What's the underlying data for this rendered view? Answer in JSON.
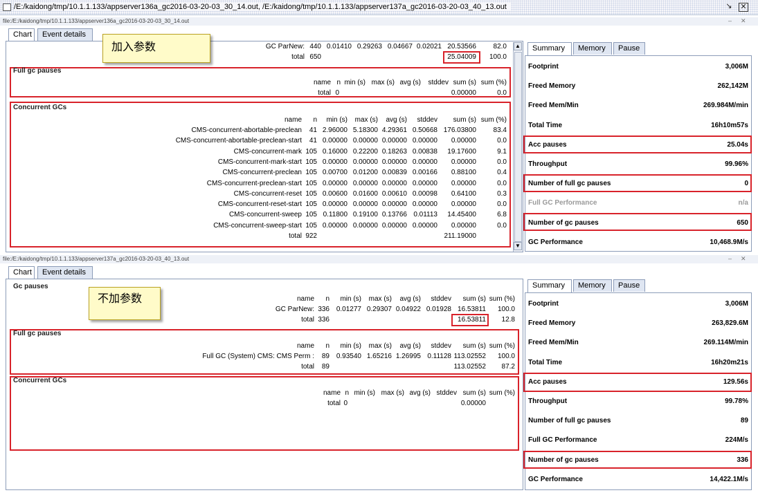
{
  "window": {
    "title": "/E:/kaidong/tmp/10.1.1.133/appserver136a_gc2016-03-20-03_30_14.out, /E:/kaidong/tmp/10.1.1.133/appserver137a_gc2016-03-20-03_40_13.out",
    "restore_icon": "restore-icon",
    "close_icon": "close-icon"
  },
  "top": {
    "file_label": "file:/E:/kaidong/tmp/10.1.1.133/appserver136a_gc2016-03-20-03_30_14.out",
    "tabs": [
      "Chart",
      "Event details"
    ],
    "note": "加入参数",
    "gc_parnew": {
      "name": "GC ParNew:",
      "n": "440",
      "min": "0.01410",
      "max": "0.29263",
      "avg": "0.04667",
      "stddev": "0.02021",
      "sum": "20.53566",
      "pct": "82.0"
    },
    "gc_total": {
      "name": "total",
      "n": "650",
      "sum": "25.04009",
      "pct": "100.0"
    },
    "full_gc": {
      "title": "Full gc pauses",
      "headers": [
        "name",
        "n",
        "min (s)",
        "max (s)",
        "avg (s)",
        "stddev",
        "sum (s)",
        "sum (%)"
      ],
      "total": {
        "name": "total",
        "n": "0",
        "sum": "0.00000",
        "pct": "0.0"
      }
    },
    "concurrent": {
      "title": "Concurrent GCs",
      "headers": [
        "name",
        "n",
        "min (s)",
        "max (s)",
        "avg (s)",
        "stddev",
        "sum (s)",
        "sum (%)"
      ],
      "rows": [
        {
          "name": "CMS-concurrent-abortable-preclean",
          "n": "41",
          "min": "2.96000",
          "max": "5.18300",
          "avg": "4.29361",
          "stddev": "0.50668",
          "sum": "176.03800",
          "pct": "83.4"
        },
        {
          "name": "CMS-concurrent-abortable-preclean-start",
          "n": "41",
          "min": "0.00000",
          "max": "0.00000",
          "avg": "0.00000",
          "stddev": "0.00000",
          "sum": "0.00000",
          "pct": "0.0"
        },
        {
          "name": "CMS-concurrent-mark",
          "n": "105",
          "min": "0.16000",
          "max": "0.22200",
          "avg": "0.18263",
          "stddev": "0.00838",
          "sum": "19.17600",
          "pct": "9.1"
        },
        {
          "name": "CMS-concurrent-mark-start",
          "n": "105",
          "min": "0.00000",
          "max": "0.00000",
          "avg": "0.00000",
          "stddev": "0.00000",
          "sum": "0.00000",
          "pct": "0.0"
        },
        {
          "name": "CMS-concurrent-preclean",
          "n": "105",
          "min": "0.00700",
          "max": "0.01200",
          "avg": "0.00839",
          "stddev": "0.00166",
          "sum": "0.88100",
          "pct": "0.4"
        },
        {
          "name": "CMS-concurrent-preclean-start",
          "n": "105",
          "min": "0.00000",
          "max": "0.00000",
          "avg": "0.00000",
          "stddev": "0.00000",
          "sum": "0.00000",
          "pct": "0.0"
        },
        {
          "name": "CMS-concurrent-reset",
          "n": "105",
          "min": "0.00600",
          "max": "0.01600",
          "avg": "0.00610",
          "stddev": "0.00098",
          "sum": "0.64100",
          "pct": "0.3"
        },
        {
          "name": "CMS-concurrent-reset-start",
          "n": "105",
          "min": "0.00000",
          "max": "0.00000",
          "avg": "0.00000",
          "stddev": "0.00000",
          "sum": "0.00000",
          "pct": "0.0"
        },
        {
          "name": "CMS-concurrent-sweep",
          "n": "105",
          "min": "0.11800",
          "max": "0.19100",
          "avg": "0.13766",
          "stddev": "0.01113",
          "sum": "14.45400",
          "pct": "6.8"
        },
        {
          "name": "CMS-concurrent-sweep-start",
          "n": "105",
          "min": "0.00000",
          "max": "0.00000",
          "avg": "0.00000",
          "stddev": "0.00000",
          "sum": "0.00000",
          "pct": "0.0"
        }
      ],
      "total": {
        "name": "total",
        "n": "922",
        "sum": "211.19000"
      }
    },
    "summary_tabs": [
      "Summary",
      "Memory",
      "Pause"
    ],
    "summary": [
      {
        "label": "Footprint",
        "value": "3,006M"
      },
      {
        "label": "Freed Memory",
        "value": "262,142M"
      },
      {
        "label": "Freed Mem/Min",
        "value": "269.984M/min"
      },
      {
        "label": "Total Time",
        "value": "16h10m57s"
      },
      {
        "label": "Acc pauses",
        "value": "25.04s"
      },
      {
        "label": "Throughput",
        "value": "99.96%"
      },
      {
        "label": "Number of full gc pauses",
        "value": "0"
      },
      {
        "label": "Full GC Performance",
        "value": "n/a"
      },
      {
        "label": "Number of gc pauses",
        "value": "650"
      },
      {
        "label": "GC Performance",
        "value": "10,468.9M/s"
      }
    ]
  },
  "bottom": {
    "file_label": "file:/E:/kaidong/tmp/10.1.1.133/appserver137a_gc2016-03-20-03_40_13.out",
    "tabs": [
      "Chart",
      "Event details"
    ],
    "note": "不加参数",
    "gc": {
      "title": "Gc pauses",
      "headers": [
        "name",
        "n",
        "min (s)",
        "max (s)",
        "avg (s)",
        "stddev",
        "sum (s)",
        "sum (%)"
      ],
      "parnew": {
        "name": "GC ParNew:",
        "n": "336",
        "min": "0.01277",
        "max": "0.29307",
        "avg": "0.04922",
        "stddev": "0.01928",
        "sum": "16.53811",
        "pct": "100.0"
      },
      "total": {
        "name": "total",
        "n": "336",
        "sum": "16.53811",
        "pct": "12.8"
      }
    },
    "full_gc": {
      "title": "Full gc pauses",
      "headers": [
        "name",
        "n",
        "min (s)",
        "max (s)",
        "avg (s)",
        "stddev",
        "sum (s)",
        "sum (%)"
      ],
      "row": {
        "name": "Full GC (System) CMS: CMS Perm :",
        "n": "89",
        "min": "0.93540",
        "max": "1.65216",
        "avg": "1.26995",
        "stddev": "0.11128",
        "sum": "113.02552",
        "pct": "100.0"
      },
      "total": {
        "name": "total",
        "n": "89",
        "sum": "113.02552",
        "pct": "87.2"
      }
    },
    "concurrent": {
      "title": "Concurrent GCs",
      "headers": [
        "name",
        "n",
        "min (s)",
        "max (s)",
        "avg (s)",
        "stddev",
        "sum (s)",
        "sum (%)"
      ],
      "total": {
        "name": "total",
        "n": "0",
        "sum": "0.00000"
      }
    },
    "summary_tabs": [
      "Summary",
      "Memory",
      "Pause"
    ],
    "summary": [
      {
        "label": "Footprint",
        "value": "3,006M"
      },
      {
        "label": "Freed Memory",
        "value": "263,829.6M"
      },
      {
        "label": "Freed Mem/Min",
        "value": "269.114M/min"
      },
      {
        "label": "Total Time",
        "value": "16h20m21s"
      },
      {
        "label": "Acc pauses",
        "value": "129.56s"
      },
      {
        "label": "Throughput",
        "value": "99.78%"
      },
      {
        "label": "Number of full gc pauses",
        "value": "89"
      },
      {
        "label": "Full GC Performance",
        "value": "224M/s"
      },
      {
        "label": "Number of gc pauses",
        "value": "336"
      },
      {
        "label": "GC Performance",
        "value": "14,422.1M/s"
      }
    ]
  }
}
